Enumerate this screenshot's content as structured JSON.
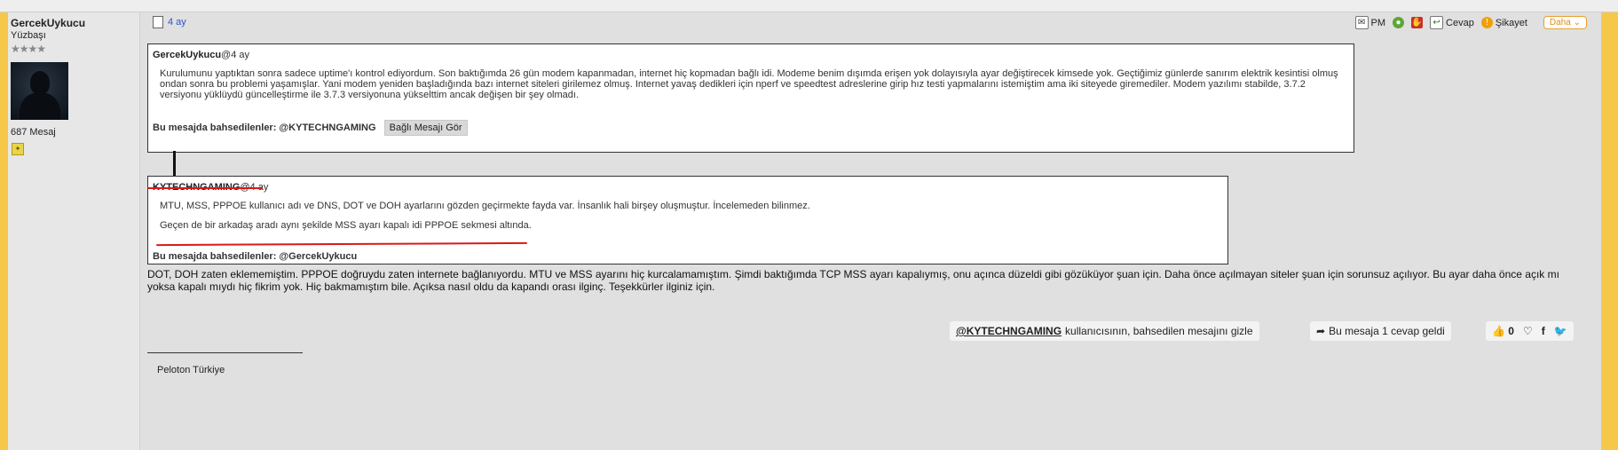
{
  "author": {
    "username": "GercekUykucu",
    "rank": "Yüzbaşı",
    "stars": "★★★★",
    "message_count": "687 Mesaj"
  },
  "post": {
    "time": "4 ay",
    "toolbar": {
      "pm": "PM",
      "reply": "Cevap",
      "report": "Şikayet",
      "more": "Daha"
    },
    "quote1": {
      "author": "GercekUykucu",
      "time": "@4 ay",
      "body": "Kurulumunu yaptıktan sonra sadece uptime'ı kontrol ediyordum. Son baktığımda 26 gün modem kapanmadan, internet hiç kopmadan bağlı idi. Modeme benim dışımda erişen yok dolayısıyla ayar değiştirecek kimsede yok. Geçtiğimiz günlerde sanırım elektrik kesintisi olmuş ondan sonra bu problemi yaşamışlar. Yani modem yeniden başladığında bazı internet siteleri girilemez olmuş. Internet yavaş dedikleri için nperf ve speedtest adreslerine girip hız testi yapmalarını istemiştim ama iki siteyede giremediler. Modem yazılımı stabilde, 3.7.2 versiyonu yüklüydü güncelleştirme ile 3.7.3 versiyonuna yükselttim ancak değişen bir şey olmadı.",
      "mentions": "Bu mesajda bahsedilenler: @KYTECHNGAMING",
      "linked_button": "Bağlı Mesajı Gör"
    },
    "quote2": {
      "author": "KYTECHNGAMING",
      "time": "@4 ay",
      "line1": "MTU, MSS, PPPOE kullanıcı adı ve DNS, DOT ve DOH ayarlarını gözden geçirmekte fayda var. İnsanlık hali birşey oluşmuştur. İncelemeden bilinmez.",
      "line2": "Geçen de bir arkadaş aradı aynı şekilde MSS ayarı kapalı idi PPPOE sekmesi altında.",
      "mentions": "Bu mesajda bahsedilenler: @GercekUykucu"
    },
    "body": "DOT, DOH zaten eklememiştim. PPPOE doğruydu zaten internete bağlanıyordu. MTU ve MSS ayarını hiç kurcalamamıştım. Şimdi baktığımda TCP MSS ayarı kapalıymış, onu açınca düzeldi gibi gözüküyor şuan için. Daha önce açılmayan siteler şuan için sorunsuz açılıyor. Bu ayar daha önce açık mı yoksa kapalı mıydı hiç fikrim yok. Hiç bakmamıştım bile. Açıksa nasıl oldu da kapandı orası ilginç. Teşekkürler ilginiz için.",
    "hide_mention": {
      "user": "@KYTECHNGAMING",
      "text": "kullanıcısının, bahsedilen mesajını gizle"
    },
    "reply_count": "Bu mesaja 1 cevap geldi",
    "likes": "0",
    "signature": "Peloton Türkiye"
  },
  "colors": {
    "page_background": "#f6c84a",
    "link": "#2c55c8",
    "annotation_red": "#d81a1a",
    "more_button": "#e08d10"
  },
  "icons": [
    "document-icon",
    "pm-icon",
    "user-icon",
    "hand-icon",
    "reply-icon",
    "report-icon",
    "chevron-down-icon",
    "share-arrow-icon",
    "thumbs-up-icon",
    "heart-icon",
    "facebook-icon",
    "twitter-icon",
    "medal-icon"
  ]
}
